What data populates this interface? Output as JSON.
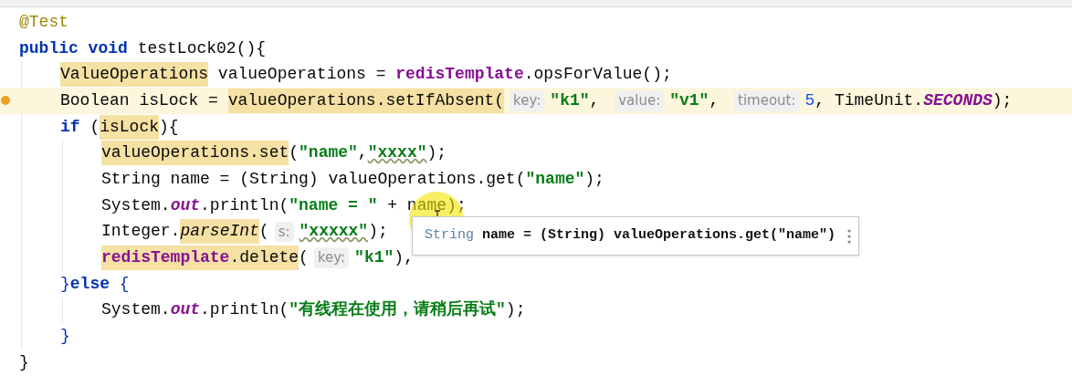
{
  "lines": [
    {
      "current": false,
      "tokens": [
        {
          "kind": "annotation",
          "text": "@Test",
          "highlighted": false
        }
      ]
    },
    {
      "current": false,
      "tokens": [
        {
          "kind": "keyword",
          "text": "public void",
          "highlighted": false
        },
        {
          "kind": "plain",
          "text": " testLock02(){",
          "highlighted": false
        }
      ],
      "children": [
        {
          "current": false,
          "tokens": [
            {
              "kind": "plain",
              "text": "ValueOperations",
              "highlighted": true
            },
            {
              "kind": "plain",
              "text": " valueOperations = ",
              "highlighted": false
            },
            {
              "kind": "field",
              "text": "redisTemplate",
              "highlighted": false
            },
            {
              "kind": "plain",
              "text": ".opsForValue();",
              "highlighted": false
            }
          ]
        },
        {
          "current": true,
          "warning": true,
          "tokens": [
            {
              "kind": "plain",
              "text": "Boolean isLock = ",
              "highlighted": false
            },
            {
              "kind": "plain",
              "text": "valueOperations.setIfAbsent(",
              "highlighted": true
            },
            {
              "kind": "hint",
              "text": "key:"
            },
            {
              "kind": "string",
              "text": "\"k1\"",
              "highlighted": false
            },
            {
              "kind": "plain",
              "text": ", ",
              "highlighted": false
            },
            {
              "kind": "hint",
              "text": "value:"
            },
            {
              "kind": "string",
              "text": "\"v1\"",
              "highlighted": false
            },
            {
              "kind": "plain",
              "text": ", ",
              "highlighted": false
            },
            {
              "kind": "hint",
              "text": "timeout:"
            },
            {
              "kind": "number",
              "text": "5",
              "highlighted": false
            },
            {
              "kind": "plain",
              "text": ", TimeUnit.",
              "highlighted": false
            },
            {
              "kind": "static-field",
              "text": "SECONDS",
              "highlighted": false
            },
            {
              "kind": "plain",
              "text": ");",
              "highlighted": false
            }
          ]
        },
        {
          "current": false,
          "tokens": [
            {
              "kind": "keyword",
              "text": "if",
              "highlighted": false
            },
            {
              "kind": "plain",
              "text": " (",
              "highlighted": false
            },
            {
              "kind": "plain",
              "text": "isLock",
              "highlighted": true
            },
            {
              "kind": "plain",
              "text": "){",
              "highlighted": false
            }
          ],
          "children": [
            {
              "current": false,
              "tokens": [
                {
                  "kind": "plain",
                  "text": "valueOperations.set",
                  "highlighted": true
                },
                {
                  "kind": "plain",
                  "text": "(",
                  "highlighted": false
                },
                {
                  "kind": "string",
                  "text": "\"name\"",
                  "highlighted": false
                },
                {
                  "kind": "plain",
                  "text": ",",
                  "highlighted": false
                },
                {
                  "kind": "typo",
                  "text": "\"xxxx\"",
                  "highlighted": false
                },
                {
                  "kind": "plain",
                  "text": ");",
                  "highlighted": false
                }
              ]
            },
            {
              "current": false,
              "tokens": [
                {
                  "kind": "plain",
                  "text": "String name = (String) valueOperations.get(",
                  "highlighted": false
                },
                {
                  "kind": "string",
                  "text": "\"name\"",
                  "highlighted": false
                },
                {
                  "kind": "plain",
                  "text": ");",
                  "highlighted": false
                }
              ]
            },
            {
              "current": false,
              "tokens": [
                {
                  "kind": "plain",
                  "text": "System.",
                  "highlighted": false
                },
                {
                  "kind": "static-field",
                  "text": "out",
                  "highlighted": false
                },
                {
                  "kind": "plain",
                  "text": ".println(",
                  "highlighted": false
                },
                {
                  "kind": "string",
                  "text": "\"name = \"",
                  "highlighted": false
                },
                {
                  "kind": "plain",
                  "text": " + name);",
                  "highlighted": false
                }
              ]
            },
            {
              "current": false,
              "tokens": [
                {
                  "kind": "plain",
                  "text": "Integer.",
                  "highlighted": false
                },
                {
                  "kind": "static-method",
                  "text": "parseInt",
                  "highlighted": true
                },
                {
                  "kind": "plain",
                  "text": "(",
                  "highlighted": false
                },
                {
                  "kind": "hint",
                  "text": "s:"
                },
                {
                  "kind": "typo",
                  "text": "\"xxxxx\"",
                  "highlighted": false
                },
                {
                  "kind": "plain",
                  "text": ");",
                  "highlighted": false
                }
              ]
            },
            {
              "current": false,
              "tokens": [
                {
                  "kind": "field",
                  "text": "redisTemplate",
                  "highlighted": true
                },
                {
                  "kind": "plain",
                  "text": ".delete",
                  "highlighted": true
                },
                {
                  "kind": "plain",
                  "text": "(",
                  "highlighted": false
                },
                {
                  "kind": "hint",
                  "text": "key:"
                },
                {
                  "kind": "string",
                  "text": "\"k1\"",
                  "highlighted": false
                },
                {
                  "kind": "plain",
                  "text": "),",
                  "highlighted": false
                }
              ]
            }
          ]
        },
        {
          "current": false,
          "tokens": [
            {
              "kind": "brace",
              "text": "}",
              "highlighted": false
            },
            {
              "kind": "keyword",
              "text": "else",
              "highlighted": false
            },
            {
              "kind": "brace",
              "text": " {",
              "highlighted": false
            }
          ],
          "children": [
            {
              "current": false,
              "tokens": [
                {
                  "kind": "plain",
                  "text": "System.",
                  "highlighted": false
                },
                {
                  "kind": "static-field",
                  "text": "out",
                  "highlighted": false
                },
                {
                  "kind": "plain",
                  "text": ".println(",
                  "highlighted": false
                },
                {
                  "kind": "string",
                  "text": "\"有线程在使用，请稍后再试\"",
                  "highlighted": false
                },
                {
                  "kind": "plain",
                  "text": ");",
                  "highlighted": false
                }
              ]
            }
          ]
        },
        {
          "current": false,
          "tokens": [
            {
              "kind": "brace",
              "text": "}",
              "highlighted": false
            }
          ]
        }
      ]
    },
    {
      "current": false,
      "tokens": [
        {
          "kind": "plain",
          "text": "}",
          "highlighted": false
        }
      ]
    }
  ],
  "popup": {
    "type_text": "String",
    "code": "name = (String) valueOperations.get(\"name\")"
  }
}
